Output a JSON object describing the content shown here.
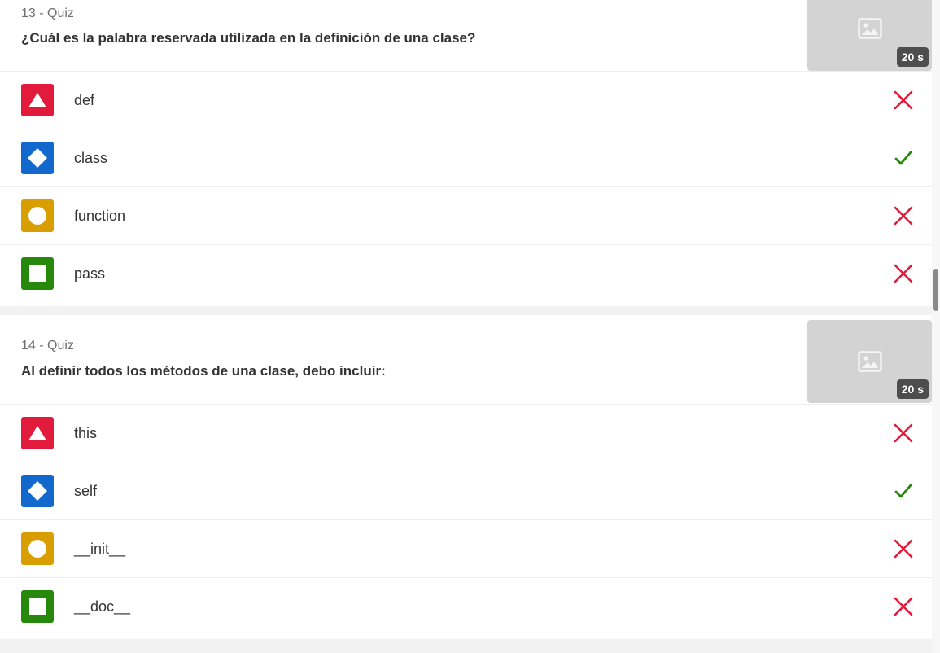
{
  "colors": {
    "triangle": "#e21b3c",
    "diamond": "#1368ce",
    "circle": "#d89e00",
    "square": "#26890c",
    "correct": "#26890c",
    "incorrect": "#e21b3c"
  },
  "questions": [
    {
      "number_label": "13 - Quiz",
      "text": "¿Cuál es la palabra reservada utilizada en la definición de una clase?",
      "time_limit": "20 s",
      "media_icon": "image-placeholder-icon",
      "answers": [
        {
          "shape": "triangle",
          "text": "def",
          "correct": false
        },
        {
          "shape": "diamond",
          "text": "class",
          "correct": true
        },
        {
          "shape": "circle",
          "text": "function",
          "correct": false
        },
        {
          "shape": "square",
          "text": "pass",
          "correct": false
        }
      ]
    },
    {
      "number_label": "14 - Quiz",
      "text": "Al definir todos los métodos de una clase, debo incluir:",
      "time_limit": "20 s",
      "media_icon": "image-placeholder-icon",
      "answers": [
        {
          "shape": "triangle",
          "text": "this",
          "correct": false
        },
        {
          "shape": "diamond",
          "text": "self",
          "correct": true
        },
        {
          "shape": "circle",
          "text": "__init__",
          "correct": false
        },
        {
          "shape": "square",
          "text": "__doc__",
          "correct": false
        }
      ]
    }
  ]
}
